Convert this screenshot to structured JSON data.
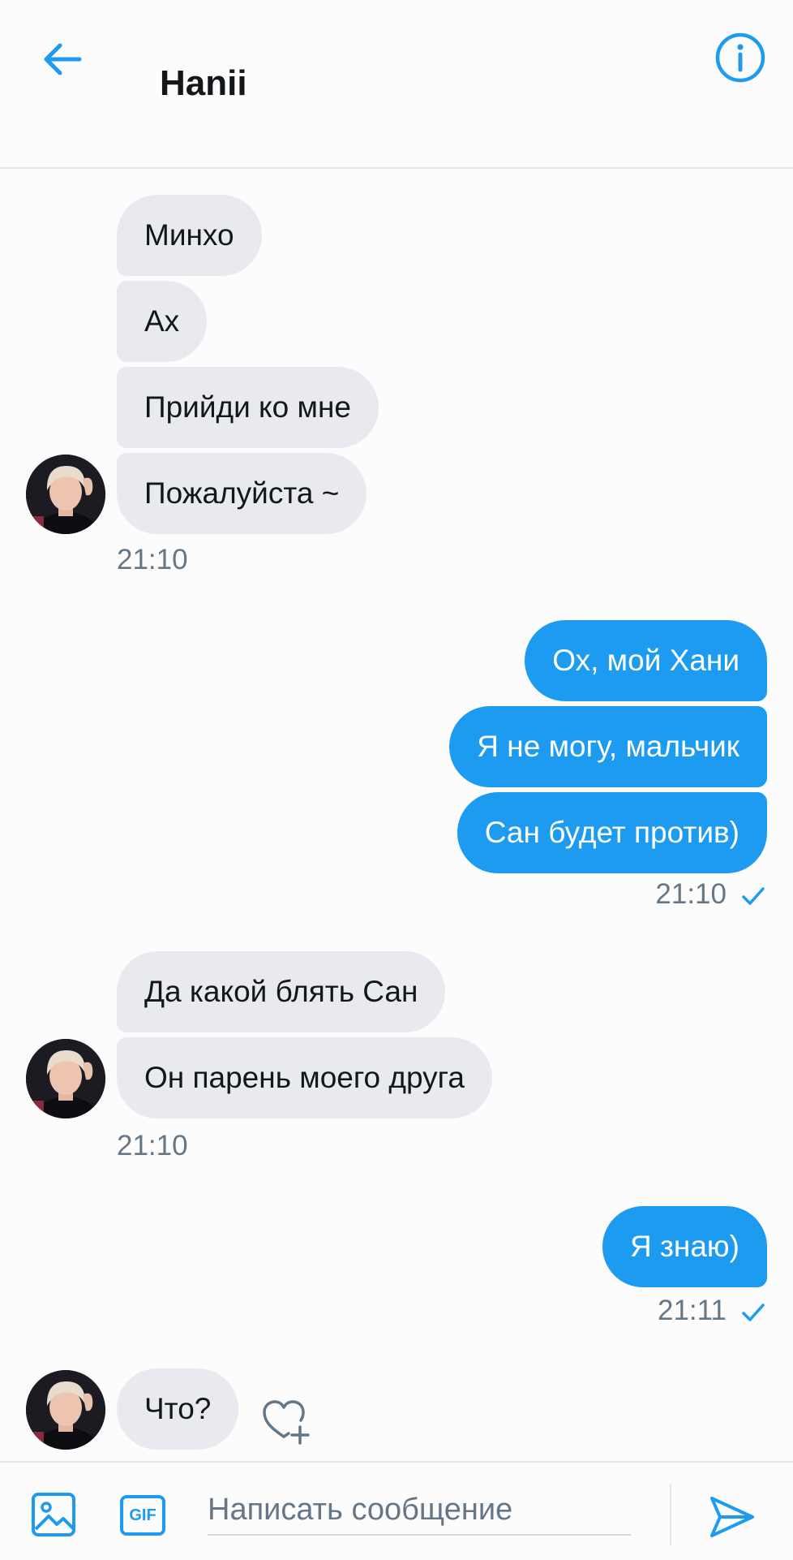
{
  "header": {
    "title": "Hanii"
  },
  "messages": [
    {
      "text": "Минхо"
    },
    {
      "text": "Ах"
    },
    {
      "text": "Прийди ко мне"
    },
    {
      "text": "Пожалуйста ~"
    },
    {
      "text": "Ох, мой Хани"
    },
    {
      "text": "Я не могу, мальчик"
    },
    {
      "text": "Сан будет против)"
    },
    {
      "text": "Да какой блять Сан"
    },
    {
      "text": "Он парень моего друга"
    },
    {
      "text": "Я знаю)"
    },
    {
      "text": "Что?"
    }
  ],
  "timestamps": [
    "21:10",
    "21:10",
    "21:10",
    "21:11"
  ],
  "composer": {
    "placeholder": "Написать сообщение",
    "gif_label": "GIF"
  },
  "colors": {
    "accent": "#1c9bf0",
    "incoming_bubble": "#e8eaef",
    "muted_text": "#657786"
  }
}
